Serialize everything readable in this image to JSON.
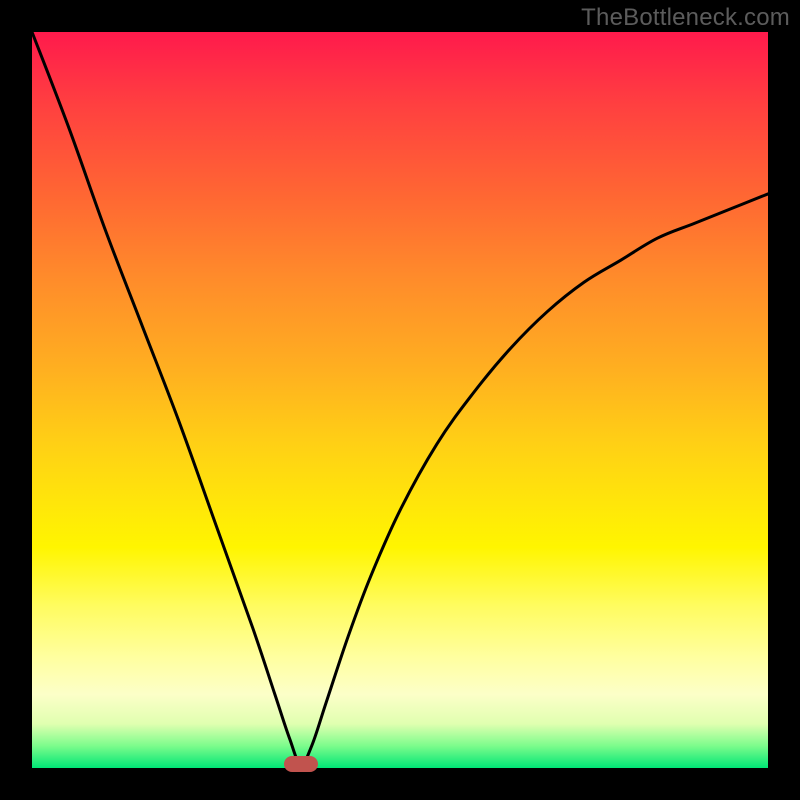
{
  "watermark": "TheBottleneck.com",
  "chart_data": {
    "type": "line",
    "title": "",
    "xlabel": "",
    "ylabel": "",
    "xlim": [
      0,
      100
    ],
    "ylim": [
      0,
      100
    ],
    "series": [
      {
        "name": "bottleneck-curve",
        "x": [
          0,
          5,
          10,
          15,
          20,
          25,
          30,
          33,
          35,
          36.5,
          38,
          40,
          43,
          46,
          50,
          55,
          60,
          65,
          70,
          75,
          80,
          85,
          90,
          95,
          100
        ],
        "values": [
          100,
          87,
          73,
          60,
          47,
          33,
          19,
          10,
          4,
          0.5,
          3,
          9,
          18,
          26,
          35,
          44,
          51,
          57,
          62,
          66,
          69,
          72,
          74,
          76,
          78
        ]
      }
    ],
    "valley_marker": {
      "x": 36.5,
      "y": 0.5
    },
    "gradient_stops": [
      {
        "pct": 0,
        "color": "#ff1a4c"
      },
      {
        "pct": 50,
        "color": "#ffe000"
      },
      {
        "pct": 100,
        "color": "#00e676"
      }
    ]
  }
}
